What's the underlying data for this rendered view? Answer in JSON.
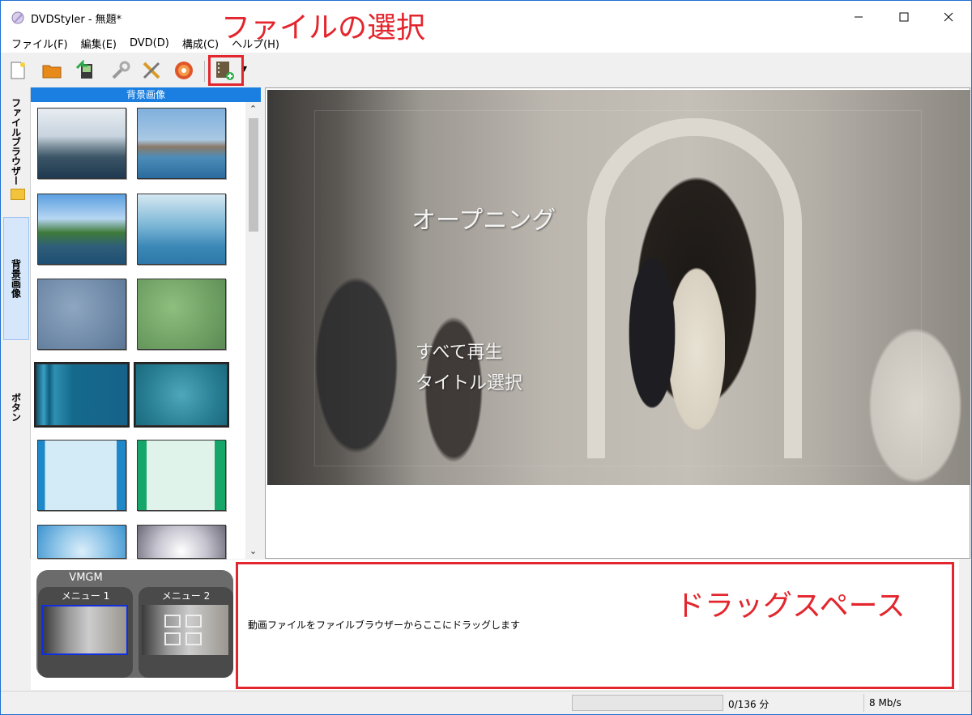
{
  "window": {
    "title": "DVDStyler - 無題*",
    "controls": {
      "minimize": "—",
      "maximize": "☐",
      "close": "✕"
    }
  },
  "menubar": {
    "items": [
      "ファイル(F)",
      "編集(E)",
      "DVD(D)",
      "構成(C)",
      "ヘルプ(H)"
    ]
  },
  "toolbar": {
    "buttons": [
      "new-icon",
      "open-folder-icon",
      "save-icon",
      "settings-icon",
      "tools-icon",
      "burn-disc-icon",
      "add-file-icon"
    ],
    "dropdown_glyph": "▾"
  },
  "annotations": {
    "top": "ファイルの選択",
    "bottom": "ドラッグスペース",
    "color": "#e3262d"
  },
  "sidebar": {
    "tabs": [
      "ファイルブラウザー",
      "背景画像",
      "ボタン"
    ],
    "active_tab": "背景画像"
  },
  "gallery": {
    "header": "背景画像",
    "thumbnails": [
      "coastal-island",
      "ship-on-sea",
      "green-coast",
      "blue-mountain-haze",
      "blue-texture",
      "green-texture",
      "blue-stripes",
      "teal-texture",
      "light-blue-frame",
      "green-frame",
      "blue-gradient-frame",
      "grey-gradient-frame"
    ]
  },
  "preview": {
    "title_text": "オープニング",
    "buttons": [
      "すべて再生",
      "タイトル選択"
    ]
  },
  "titleset": {
    "vmgm_label": "VMGM",
    "menus": [
      {
        "label": "メニュー 1",
        "selected": true
      },
      {
        "label": "メニュー 2",
        "selected": false
      }
    ]
  },
  "drag_area": {
    "hint": "動画ファイルをファイルブラウザーからここにドラッグします"
  },
  "statusbar": {
    "duration": "0/136 分",
    "bitrate": "8 Mb/s",
    "progress": 0
  }
}
